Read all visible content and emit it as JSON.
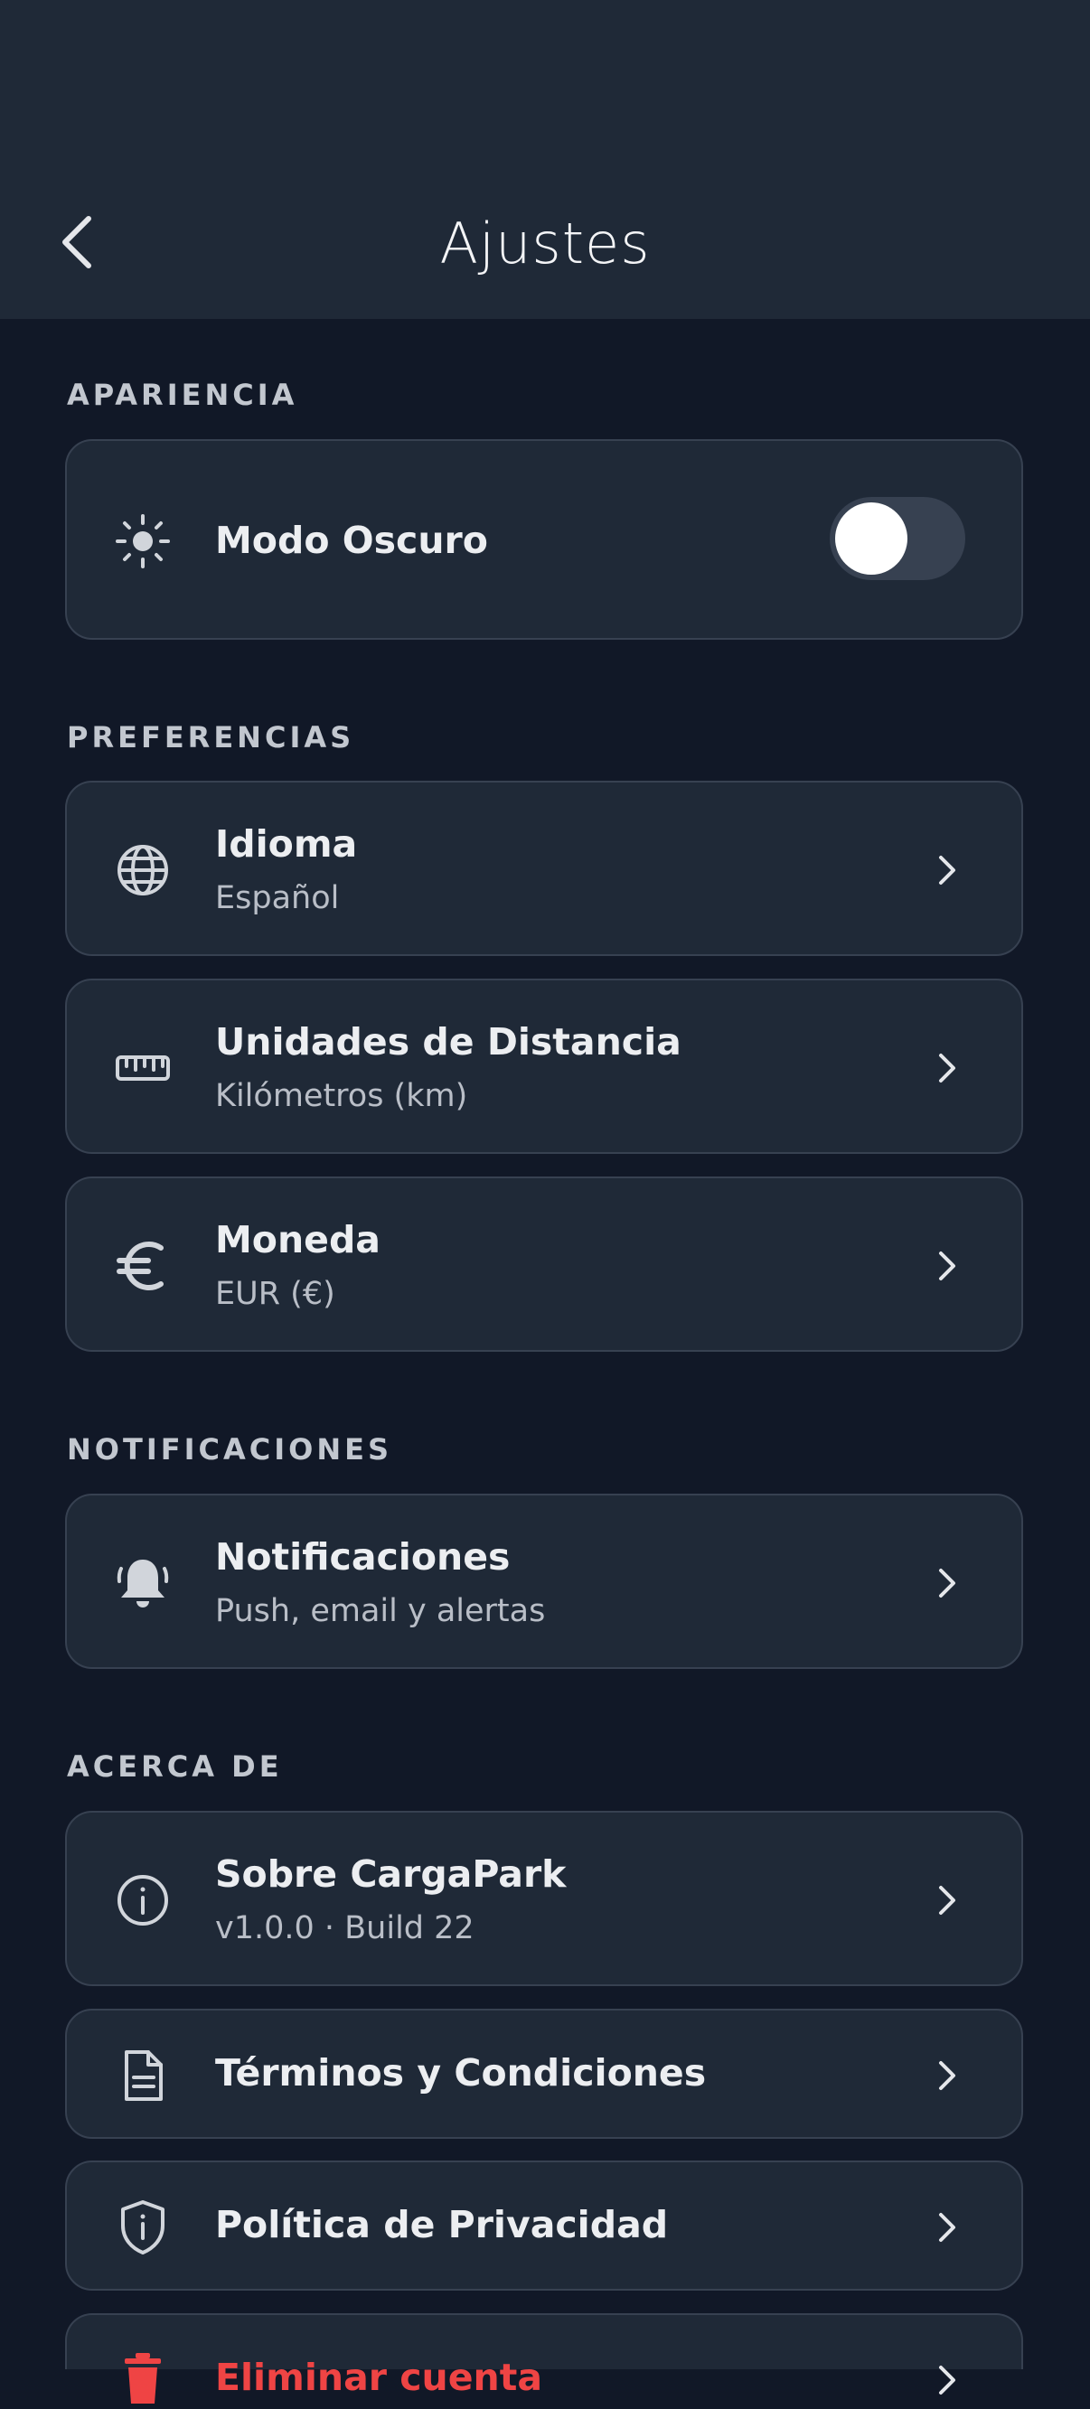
{
  "header": {
    "title": "Ajustes",
    "back_icon": "chevron-left-icon"
  },
  "sections": {
    "appearance": {
      "label": "APARIENCIA",
      "dark_mode": {
        "title": "Modo Oscuro",
        "icon": "sun-icon",
        "enabled": false
      }
    },
    "preferences": {
      "label": "PREFERENCIAS",
      "language": {
        "title": "Idioma",
        "value": "Español",
        "icon": "globe-icon"
      },
      "distance": {
        "title": "Unidades de Distancia",
        "value": "Kilómetros (km)",
        "icon": "ruler-icon"
      },
      "currency": {
        "title": "Moneda",
        "value": "EUR (€)",
        "icon": "euro-icon"
      }
    },
    "notifications": {
      "label": "NOTIFICACIONES",
      "notifications": {
        "title": "Notificaciones",
        "value": "Push, email y alertas",
        "icon": "bell-icon"
      }
    },
    "about": {
      "label": "ACERCA DE",
      "about_app": {
        "title": "Sobre CargaPark",
        "value": "v1.0.0 · Build 22",
        "icon": "info-icon"
      },
      "terms": {
        "title": "Términos y Condiciones",
        "icon": "document-icon"
      },
      "privacy": {
        "title": "Política de Privacidad",
        "icon": "shield-icon"
      },
      "delete_account": {
        "title": "Eliminar cuenta",
        "icon": "trash-icon"
      }
    }
  },
  "colors": {
    "background": "#111827",
    "surface": "#1f2937",
    "border": "#374151",
    "danger": "#ef4444"
  }
}
